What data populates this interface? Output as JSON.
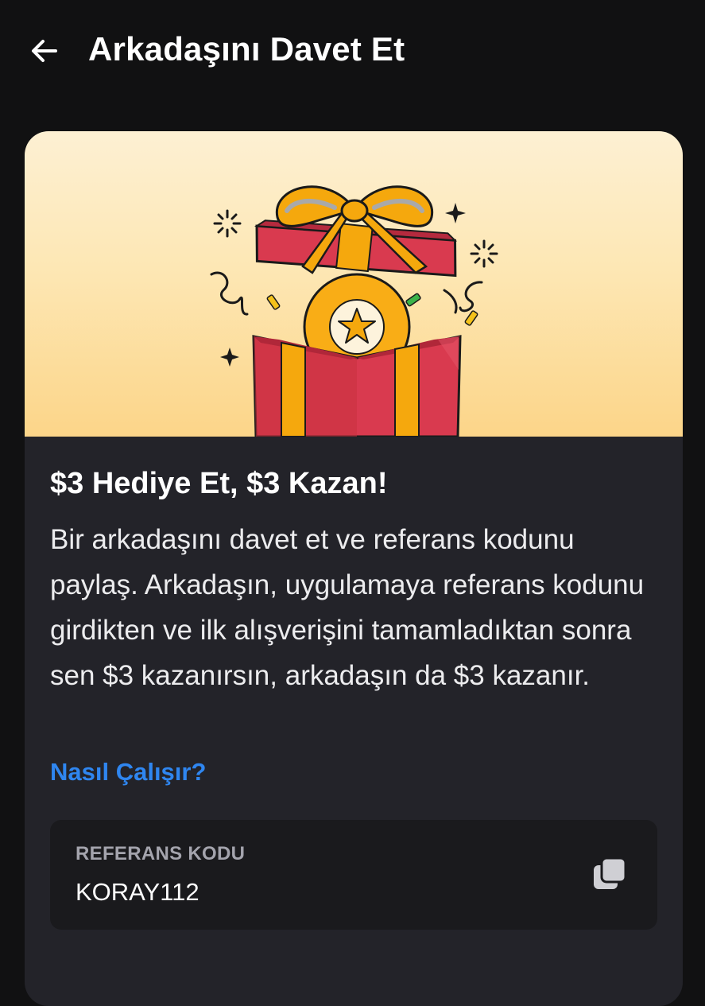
{
  "header": {
    "title": "Arkadaşını Davet Et",
    "back_icon": "arrow-left-icon"
  },
  "banner": {
    "illustration": "gift-box-with-star-coin",
    "colors": {
      "bg_top": "#fdf0d3",
      "bg_bottom": "#fcd589",
      "box_red": "#d93a4f",
      "ribbon_gold": "#f5a80d",
      "coin_gold": "#f9ad16"
    }
  },
  "promo": {
    "title": "$3 Hediye Et, $3 Kazan!",
    "description": "Bir arkadaşını davet et ve referans kodunu paylaş. Arkadaşın, uygulamaya referans kodunu girdikten ve ilk alışverişini tamamladıktan sonra sen $3 kazanırsın, arkadaşın da $3 kazanır.",
    "link_label": "Nasıl Çalışır?"
  },
  "referral": {
    "label": "REFERANS KODU",
    "code": "KORAY112",
    "copy_icon": "copy-icon"
  },
  "colors": {
    "background": "#111112",
    "card": "#232329",
    "code_box": "#1a1a1d",
    "link": "#2f86f0"
  }
}
